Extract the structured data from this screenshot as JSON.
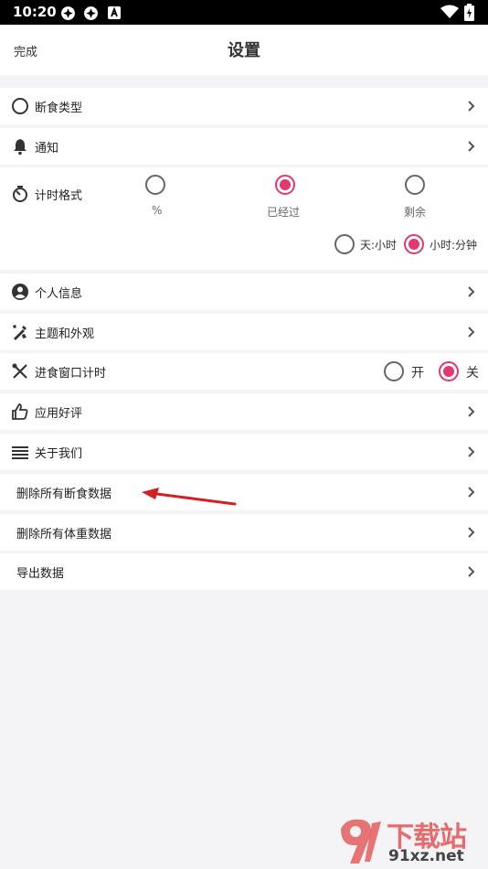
{
  "status_bar": {
    "time": "10:20"
  },
  "header": {
    "done": "完成",
    "title": "设置"
  },
  "rows": {
    "fasting_type": "断食类型",
    "notification": "通知",
    "timer_format": "计时格式",
    "personal_info": "个人信息",
    "theme": "主题和外观",
    "eating_window": "进食窗口计时",
    "rate_app": "应用好评",
    "about": "关于我们",
    "delete_fasting": "删除所有断食数据",
    "delete_weight": "删除所有体重数据",
    "export": "导出数据"
  },
  "timer_format_options": {
    "percent": "%",
    "elapsed": "已经过",
    "remaining": "剩余",
    "selected": "已经过"
  },
  "time_units": {
    "day_hour": "天:小时",
    "hour_minute": "小时:分钟",
    "selected": "小时:分钟"
  },
  "eating_window_toggle": {
    "on": "开",
    "off": "关",
    "selected": "关"
  },
  "accent_color": "#e2376f",
  "watermark": {
    "text_top": "下载站",
    "text_bottom": "91xz.net"
  }
}
